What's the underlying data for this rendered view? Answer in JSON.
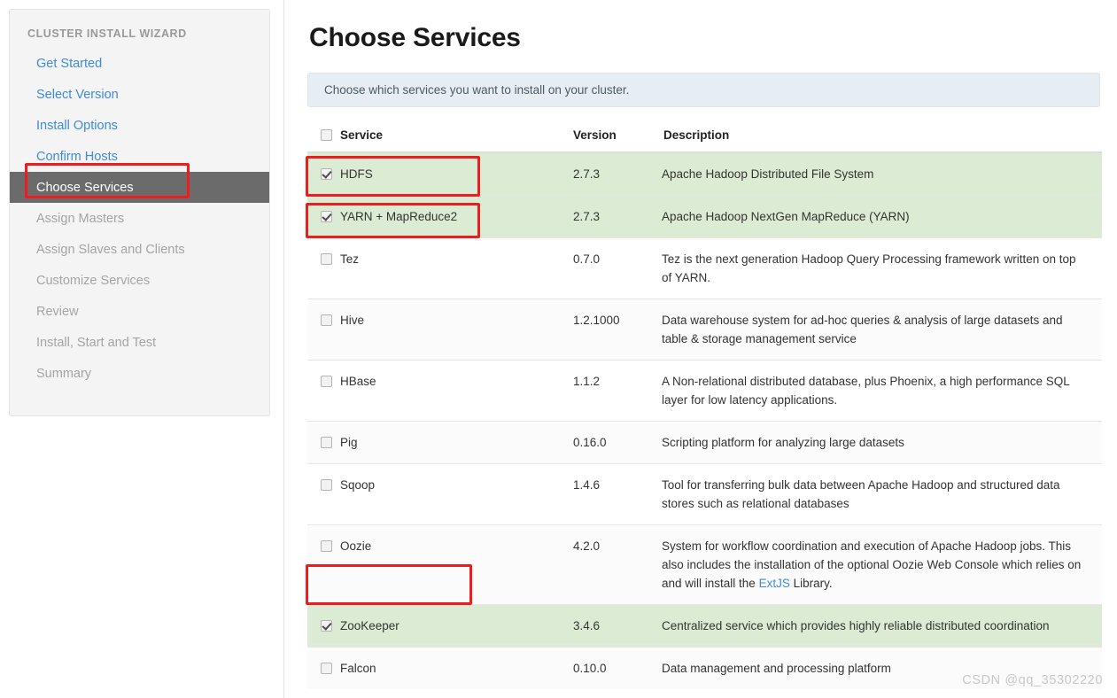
{
  "sidebar": {
    "title": "CLUSTER INSTALL WIZARD",
    "items": [
      {
        "label": "Get Started",
        "state": "done"
      },
      {
        "label": "Select Version",
        "state": "done"
      },
      {
        "label": "Install Options",
        "state": "done"
      },
      {
        "label": "Confirm Hosts",
        "state": "done"
      },
      {
        "label": "Choose Services",
        "state": "active"
      },
      {
        "label": "Assign Masters",
        "state": "disabled"
      },
      {
        "label": "Assign Slaves and Clients",
        "state": "disabled"
      },
      {
        "label": "Customize Services",
        "state": "disabled"
      },
      {
        "label": "Review",
        "state": "disabled"
      },
      {
        "label": "Install, Start and Test",
        "state": "disabled"
      },
      {
        "label": "Summary",
        "state": "disabled"
      }
    ]
  },
  "main": {
    "title": "Choose Services",
    "info": "Choose which services you want to install on your cluster.",
    "table": {
      "headers": {
        "service": "Service",
        "version": "Version",
        "description": "Description"
      },
      "rows": [
        {
          "service": "HDFS",
          "version": "2.7.3",
          "description": "Apache Hadoop Distributed File System",
          "checked": true
        },
        {
          "service": "YARN + MapReduce2",
          "version": "2.7.3",
          "description": "Apache Hadoop NextGen MapReduce (YARN)",
          "checked": true
        },
        {
          "service": "Tez",
          "version": "0.7.0",
          "description": "Tez is the next generation Hadoop Query Processing framework written on top of YARN.",
          "checked": false
        },
        {
          "service": "Hive",
          "version": "1.2.1000",
          "description": "Data warehouse system for ad-hoc queries & analysis of large datasets and table & storage management service",
          "checked": false
        },
        {
          "service": "HBase",
          "version": "1.1.2",
          "description": "A Non-relational distributed database, plus Phoenix, a high performance SQL layer for low latency applications.",
          "checked": false
        },
        {
          "service": "Pig",
          "version": "0.16.0",
          "description": "Scripting platform for analyzing large datasets",
          "checked": false
        },
        {
          "service": "Sqoop",
          "version": "1.4.6",
          "description": "Tool for transferring bulk data between Apache Hadoop and structured data stores such as relational databases",
          "checked": false
        },
        {
          "service": "Oozie",
          "version": "4.2.0",
          "description_pre": "System for workflow coordination and execution of Apache Hadoop jobs. This also includes the installation of the optional Oozie Web Console which relies on and will install the ",
          "description_link": "ExtJS",
          "description_post": " Library.",
          "checked": false
        },
        {
          "service": "ZooKeeper",
          "version": "3.4.6",
          "description": "Centralized service which provides highly reliable distributed coordination",
          "checked": true
        },
        {
          "service": "Falcon",
          "version": "0.10.0",
          "description": "Data management and processing platform",
          "checked": false
        }
      ]
    }
  },
  "annotations": {
    "color": "#ee1d1d",
    "boxes": [
      "choose-services-nav",
      "hdfs-row",
      "yarn-row",
      "zookeeper-row"
    ]
  },
  "watermark": "CSDN @qq_35302220"
}
